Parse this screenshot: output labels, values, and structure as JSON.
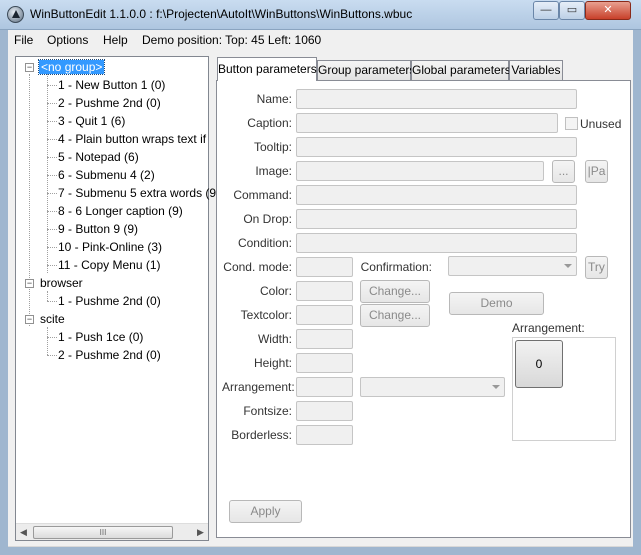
{
  "window": {
    "title": "WinButtonEdit 1.1.0.0 : f:\\Projecten\\AutoIt\\WinButtons\\WinButtons.wbuc",
    "minimize_label": "—",
    "maximize_label": "▭",
    "close_label": "✕"
  },
  "menu": {
    "file": "File",
    "options": "Options",
    "help": "Help",
    "demo_position": "Demo position: Top: 45 Left: 1060"
  },
  "tree": {
    "groups": [
      {
        "label": "<no group>",
        "items": [
          "1 - New Button 1 (0)",
          "2 - Pushme 2nd (0)",
          "3 - Quit 1 (6)",
          "4 - Plain button wraps text if",
          "5 - Notepad (6)",
          "6 - Submenu 4 (2)",
          "7 - Submenu 5 extra words (9",
          "8 - 6 Longer caption (9)",
          "9 - Button 9 (9)",
          "10 - Pink-Online (3)",
          "11 - Copy Menu (1)"
        ]
      },
      {
        "label": "browser",
        "items": [
          "1 - Pushme 2nd (0)"
        ]
      },
      {
        "label": "scite",
        "items": [
          "1 - Push 1ce (0)",
          "2 - Pushme 2nd (0)"
        ]
      }
    ],
    "scroll_thumb": "III"
  },
  "tabs": [
    "Button parameters",
    "Group parameters",
    "Global parameters",
    "Variables"
  ],
  "form": {
    "name_label": "Name:",
    "caption_label": "Caption:",
    "unused_label": "Unused",
    "tooltip_label": "Tooltip:",
    "image_label": "Image:",
    "browse_label": "...",
    "pa_label": "|Pa",
    "command_label": "Command:",
    "ondrop_label": "On Drop:",
    "condition_label": "Condition:",
    "condmode_label": "Cond. mode:",
    "confirmation_label": "Confirmation:",
    "try_label": "Try",
    "color_label": "Color:",
    "change_color_label": "Change...",
    "demo_label": "Demo",
    "textcolor_label": "Textcolor:",
    "change_textcolor_label": "Change...",
    "arrangement_right_label": "Arrangement:",
    "width_label": "Width:",
    "preview_button_label": "0",
    "height_label": "Height:",
    "arrangement_label": "Arrangement:",
    "fontsize_label": "Fontsize:",
    "borderless_label": "Borderless:",
    "apply_label": "Apply"
  }
}
